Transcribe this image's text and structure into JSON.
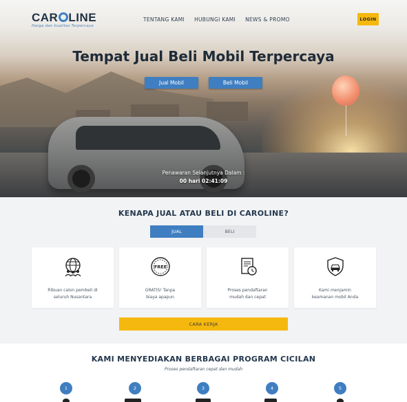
{
  "brand": {
    "name_left": "CAR",
    "name_right": "LINE",
    "tagline": "Harga dan kualitas Terpercaya"
  },
  "nav": {
    "items": [
      "TENTANG KAMI",
      "HUBUNGI KAMI",
      "NEWS & PROMO"
    ],
    "login_label": "LOGIN"
  },
  "hero": {
    "title": "Tempat Jual Beli Mobil Terpercaya",
    "sell_button": "Jual Mobil",
    "buy_button": "Beli Mobil",
    "offer_label": "Penawaran Selanjutnya Dalam :",
    "countdown": "00 hari 02:41:09"
  },
  "why": {
    "title": "KENAPA JUAL ATAU BELI DI CAROLINE?",
    "tabs": [
      "JUAL",
      "BELI"
    ],
    "active_tab": "JUAL",
    "cards": [
      {
        "icon": "globe-people-icon",
        "text": "Ribuan calon pembeli di\nseluruh Nusantara"
      },
      {
        "icon": "free-badge-icon",
        "text": "GRATIS! Tanpa\nbiaya apapun"
      },
      {
        "icon": "document-clock-icon",
        "text": "Proses pendaftaran\nmudah dan cepat"
      },
      {
        "icon": "shield-car-icon",
        "text": "Kami menjamin\nkeamanan mobil Anda"
      }
    ],
    "how_button": "CARA KERJA"
  },
  "program": {
    "title": "KAMI MENYEDIAKAN BERBAGAI PROGRAM CICILAN",
    "subtitle": "Proses pendaftaran cepat dan mudah",
    "steps": [
      "1",
      "2",
      "3",
      "4",
      "5"
    ]
  },
  "colors": {
    "accent": "#3f7ec1",
    "cta": "#f5b80e",
    "heading": "#23374d"
  }
}
